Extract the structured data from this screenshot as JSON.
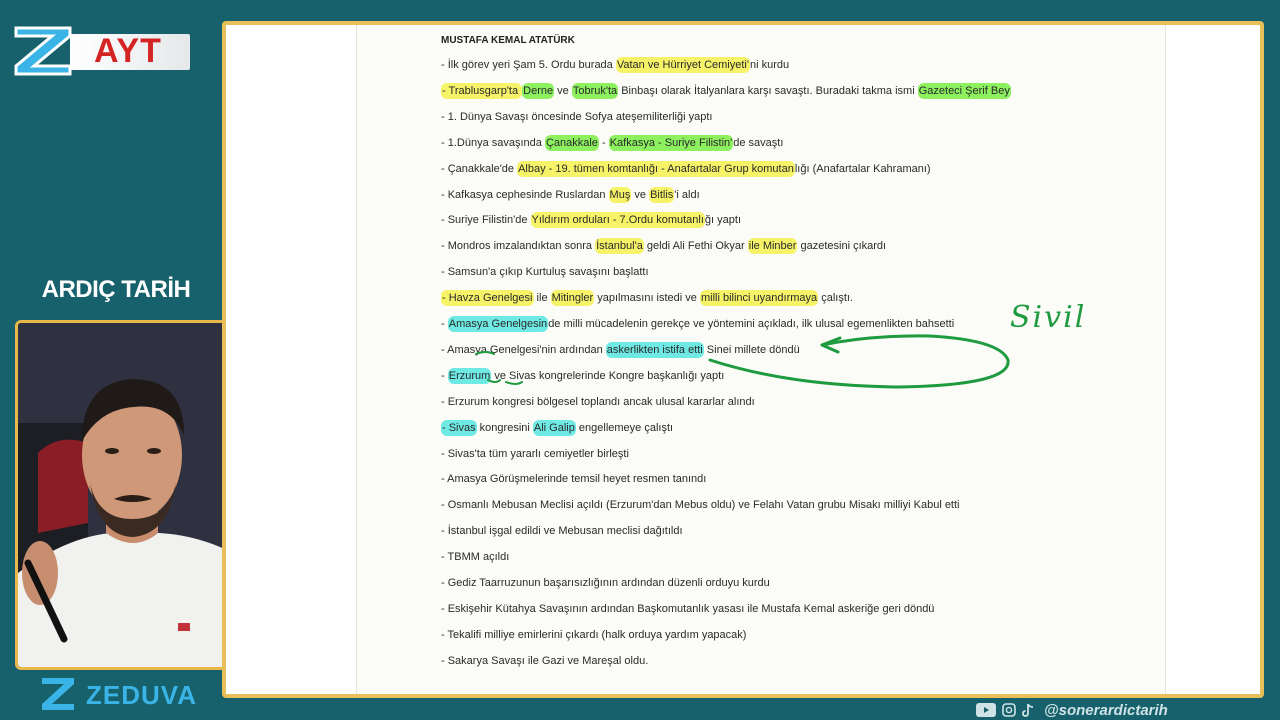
{
  "badge": {
    "label": "AYT"
  },
  "presenter": {
    "channel": "ARDIÇ TARİH"
  },
  "brand": {
    "name": "ZEDUVA"
  },
  "social": {
    "handle": "@sonerardictarih",
    "icons": [
      "youtube-icon",
      "instagram-icon",
      "tiktok-icon"
    ]
  },
  "annotation": {
    "text": "Sivil",
    "color": "#1e9a3f"
  },
  "colors": {
    "background": "#16616b",
    "frame": "#e8bf58",
    "highlight_yellow": "#f6f369",
    "highlight_green": "#8cf05f",
    "highlight_cyan": "#6fe9e3",
    "badge_red": "#d42424",
    "brand_blue": "#3ab4e6"
  },
  "document": {
    "title": "MUSTAFA KEMAL ATATÜRK",
    "lines": [
      [
        {
          "t": "- İlk görev yeri Şam 5. Ordu burada "
        },
        {
          "t": "Vatan ve Hürriyet Cemiyeti'",
          "h": "y"
        },
        {
          "t": "ni kurdu"
        }
      ],
      [
        {
          "t": "- Trablusgarp'ta ",
          "h": "y"
        },
        {
          "t": "Derne",
          "h": "g"
        },
        {
          "t": " ve "
        },
        {
          "t": "Tobruk'ta",
          "h": "g"
        },
        {
          "t": " Binbaşı olarak İtalyanlara karşı savaştı. Buradaki takma ismi "
        },
        {
          "t": "Gazeteci Şerif Bey",
          "h": "g"
        }
      ],
      [
        {
          "t": "- 1. Dünya Savaşı öncesinde Sofya ateşemiliterliği yaptı"
        }
      ],
      [
        {
          "t": "- 1.Dünya savaşında "
        },
        {
          "t": "Çanakkale",
          "h": "g"
        },
        {
          "t": " - "
        },
        {
          "t": "Kafkasya - Suriye Filistin'",
          "h": "g"
        },
        {
          "t": "de savaştı"
        }
      ],
      [
        {
          "t": "- Çanakkale'de "
        },
        {
          "t": "Albay - 19. tümen komtanlığı - Anafartalar Grup komutan",
          "h": "y"
        },
        {
          "t": "lığı (Anafartalar Kahramanı)"
        }
      ],
      [
        {
          "t": "- Kafkasya cephesinde Ruslardan "
        },
        {
          "t": "Muş",
          "h": "y"
        },
        {
          "t": " ve "
        },
        {
          "t": "Bitlis",
          "h": "y"
        },
        {
          "t": "'i aldı"
        }
      ],
      [
        {
          "t": "- Suriye Filistin'de "
        },
        {
          "t": "Yıldırım orduları - 7.Ordu komutanlı",
          "h": "y"
        },
        {
          "t": "ğı yaptı"
        }
      ],
      [
        {
          "t": "- Mondros imzalandıktan sonra "
        },
        {
          "t": "İstanbul'a",
          "h": "y"
        },
        {
          "t": " geldi Ali Fethi Okyar "
        },
        {
          "t": "ile Minber",
          "h": "y"
        },
        {
          "t": " gazetesini çıkardı"
        }
      ],
      [
        {
          "t": "- Samsun'a çıkıp Kurtuluş savaşını başlattı"
        }
      ],
      [
        {
          "t": "- Havza Genelgesi",
          "h": "y"
        },
        {
          "t": " ile "
        },
        {
          "t": "Mitingler",
          "h": "y"
        },
        {
          "t": " yapılmasını istedi ve "
        },
        {
          "t": "milli bilinci uyandırmaya",
          "h": "y"
        },
        {
          "t": " çalıştı."
        }
      ],
      [
        {
          "t": "- "
        },
        {
          "t": "Amasya Genelgesin",
          "h": "c"
        },
        {
          "t": "de milli mücadelenin gerekçe ve yöntemini açıkladı, ilk ulusal egemenlikten bahsetti"
        }
      ],
      [
        {
          "t": "- Amasya Genelgesi'nin ardından "
        },
        {
          "t": "askerlikten istifa etti",
          "h": "c"
        },
        {
          "t": " Sinei millete döndü"
        }
      ],
      [
        {
          "t": "- "
        },
        {
          "t": "Erzurum",
          "h": "c"
        },
        {
          "t": " ve Sivas kongrelerinde Kongre başkanlığı yaptı"
        }
      ],
      [
        {
          "t": "- Erzurum kongresi bölgesel toplandı ancak ulusal kararlar alındı"
        }
      ],
      [
        {
          "t": "- Sivas",
          "h": "c"
        },
        {
          "t": " kongresini "
        },
        {
          "t": "Ali Galip",
          "h": "c"
        },
        {
          "t": " engellemeye çalıştı"
        }
      ],
      [
        {
          "t": "- Sivas'ta tüm yararlı cemiyetler birleşti"
        }
      ],
      [
        {
          "t": "- Amasya Görüşmelerinde temsil heyet resmen tanındı"
        }
      ],
      [
        {
          "t": "- Osmanlı Mebusan Meclisi açıldı (Erzurum'dan Mebus oldu) ve Felahı Vatan grubu Misakı milliyi Kabul etti"
        }
      ],
      [
        {
          "t": "- İstanbul işgal edildi ve Mebusan meclisi dağıtıldı"
        }
      ],
      [
        {
          "t": "- TBMM açıldı"
        }
      ],
      [
        {
          "t": "- Gediz Taarruzunun başarısızlığının ardından düzenli orduyu kurdu"
        }
      ],
      [
        {
          "t": "- Eskişehir Kütahya Savaşının ardından Başkomutanlık yasası ile Mustafa Kemal askeriğe geri döndü"
        }
      ],
      [
        {
          "t": "- Tekalifi milliye emirlerini çıkardı (halk orduya yardım yapacak)"
        }
      ],
      [
        {
          "t": "- Sakarya Savaşı ile Gazi ve Mareşal oldu."
        }
      ]
    ]
  }
}
